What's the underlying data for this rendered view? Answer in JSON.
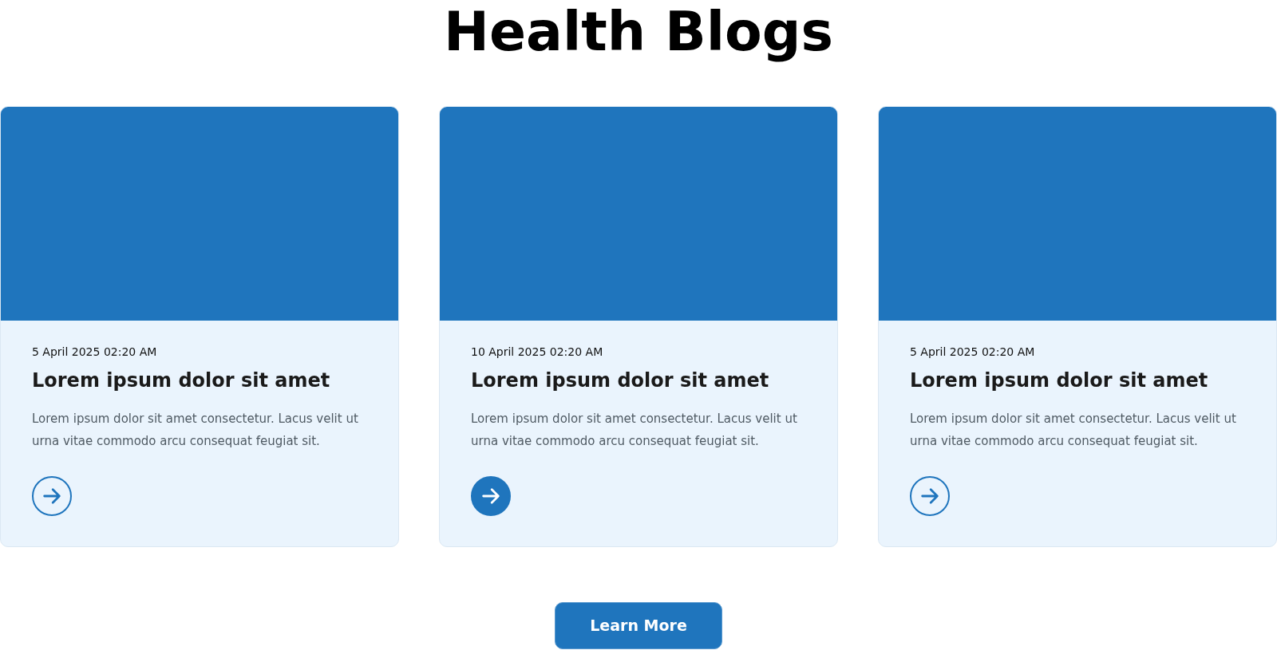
{
  "title": "Health Blogs",
  "cards": [
    {
      "date": "5 April 2025 02:20 AM",
      "heading": "Lorem ipsum dolor sit amet",
      "body": "Lorem ipsum dolor sit amet consectetur. Lacus velit ut urna vitae commodo arcu consequat feugiat sit.",
      "selected": false
    },
    {
      "date": "10 April 2025 02:20 AM",
      "heading": "Lorem ipsum dolor sit amet",
      "body": "Lorem ipsum dolor sit amet consectetur. Lacus velit ut urna vitae commodo arcu consequat feugiat sit.",
      "selected": true
    },
    {
      "date": "5 April 2025 02:20 AM",
      "heading": "Lorem ipsum dolor sit amet",
      "body": "Lorem ipsum dolor sit amet consectetur. Lacus velit ut urna vitae commodo arcu consequat feugiat sit.",
      "selected": false
    }
  ],
  "button": "Learn More"
}
